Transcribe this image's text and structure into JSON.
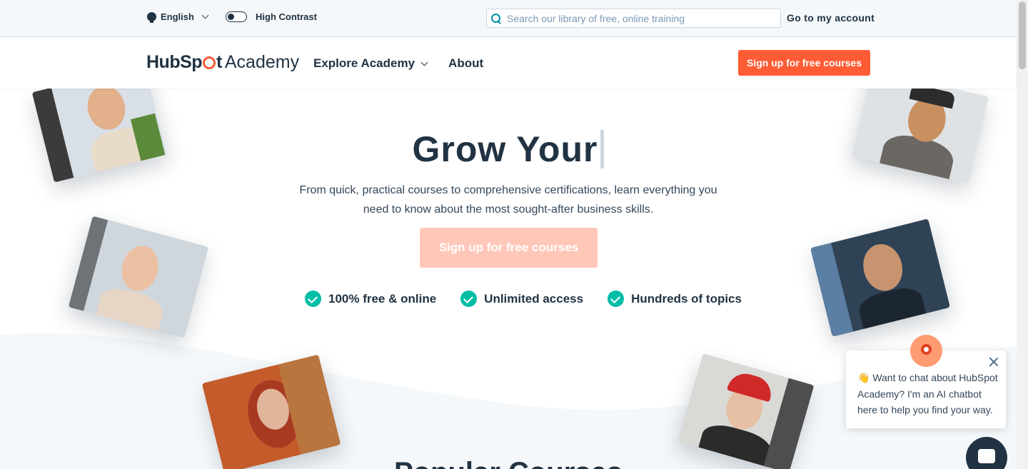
{
  "utility_bar": {
    "language": "English",
    "contrast_label": "High Contrast",
    "search_placeholder": "Search our library of free, online training",
    "account_link": "Go to my account"
  },
  "header": {
    "logo_hub": "HubSp",
    "logo_t": "t",
    "logo_academy": "Academy",
    "nav": [
      {
        "label": "Explore Academy",
        "has_dropdown": true
      },
      {
        "label": "About",
        "has_dropdown": false
      }
    ],
    "cta": "Sign up for free courses"
  },
  "hero": {
    "title": "Grow Your",
    "subtitle": "From quick, practical courses to comprehensive certifications, learn everything you need to know about the most sought-after business skills.",
    "cta": "Sign up for free courses",
    "features": [
      "100% free & online",
      "Unlimited access",
      "Hundreds of topics"
    ]
  },
  "section": {
    "popular_title": "Popular Courses"
  },
  "chat": {
    "emoji": "👋",
    "message": "Want to chat about HubSpot Academy? I'm an AI chatbot here to help you find your way."
  },
  "colors": {
    "brand_orange": "#ff5c35",
    "brand_orange_light": "#ffc7b8",
    "teal_check": "#00bda5",
    "navy": "#213343"
  },
  "icons": [
    "globe-icon",
    "chevron-down-icon",
    "contrast-toggle",
    "search-icon",
    "check-icon",
    "close-icon",
    "chat-icon"
  ]
}
